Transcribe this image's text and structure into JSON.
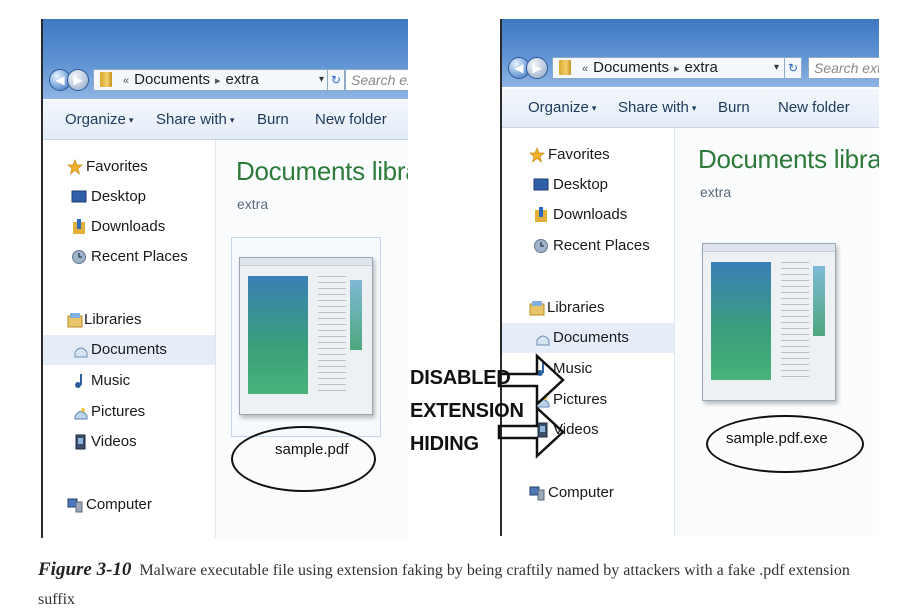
{
  "left": {
    "path": [
      "Documents",
      "extra"
    ],
    "search_placeholder": "Search extra",
    "toolbar": {
      "organize": "Organize",
      "share": "Share with",
      "burn": "Burn",
      "new_folder": "New folder"
    },
    "nav": {
      "favorites": "Favorites",
      "desktop": "Desktop",
      "downloads": "Downloads",
      "recent": "Recent Places",
      "libraries": "Libraries",
      "documents": "Documents",
      "music": "Music",
      "pictures": "Pictures",
      "videos": "Videos",
      "computer": "Computer"
    },
    "title": "Documents library",
    "subtitle": "extra",
    "file": "sample.pdf"
  },
  "right": {
    "path": [
      "Documents",
      "extra"
    ],
    "search_placeholder": "Search extra",
    "toolbar": {
      "organize": "Organize",
      "share": "Share with",
      "burn": "Burn",
      "new_folder": "New folder"
    },
    "nav": {
      "favorites": "Favorites",
      "desktop": "Desktop",
      "downloads": "Downloads",
      "recent": "Recent Places",
      "libraries": "Libraries",
      "documents": "Documents",
      "music": "Music",
      "pictures": "Pictures",
      "videos": "Videos",
      "computer": "Computer"
    },
    "title": "Documents library",
    "subtitle": "extra",
    "file": "sample.pdf.exe"
  },
  "callout": [
    "DISABLED",
    "EXTENSION",
    "HIDING"
  ],
  "caption": {
    "label": "Figure 3-10",
    "text": "Malware executable file using extension faking by being craftily named by attackers with a fake .pdf extension suffix"
  },
  "colors": {
    "library_title": "#2d7a3a",
    "titlebar": "#3f78c3",
    "selected_nav": "#e5eef8"
  }
}
